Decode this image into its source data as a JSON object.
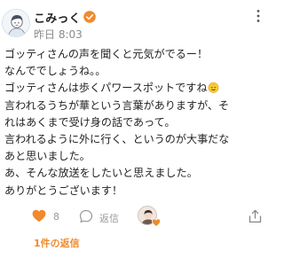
{
  "comment": {
    "user_name": "こみっく",
    "timestamp": "昨日 8:03",
    "lines": [
      "ゴッティさんの声を聞くと元気がでるー！",
      "なんででしょうね。。",
      "ゴッティさんは歩くパワースポットですね",
      "言われるうちが華という言葉がありますが、そ",
      "れはあくまで受け身の話であって。",
      "言われるように外に行く、というのが大事だな",
      "あと思いました。",
      "あ、そんな放送をしたいと思えました。",
      "ありがとうございます！"
    ],
    "emoji_icon": "smiling-face-icon"
  },
  "actions": {
    "like_count": "8",
    "reply_label": "返信"
  },
  "replies_link": "1件の返信",
  "colors": {
    "accent": "#f08a2c",
    "text": "#222222",
    "muted": "#8a8a8a"
  }
}
